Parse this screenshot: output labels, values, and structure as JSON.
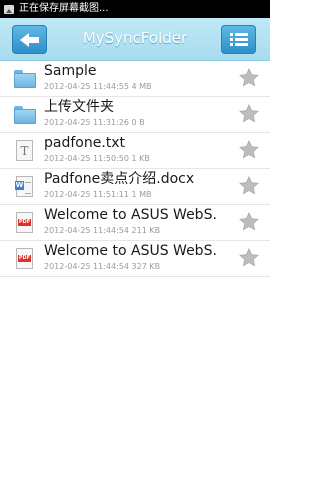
{
  "status_bar": {
    "text": "正在保存屏幕截图..."
  },
  "toolbar": {
    "title": "MySyncFolder"
  },
  "files": [
    {
      "name": "Sample",
      "date": "2012-04-25 11:44:55",
      "size": "4 MB",
      "type": "folder"
    },
    {
      "name": "上传文件夹",
      "date": "2012-04-25 11:31:26",
      "size": "0 B",
      "type": "folder"
    },
    {
      "name": "padfone.txt",
      "date": "2012-04-25 11:50:50",
      "size": "1 KB",
      "type": "txt"
    },
    {
      "name": "Padfone卖点介绍.docx",
      "date": "2012-04-25 11:51:11",
      "size": "1 MB",
      "type": "docx"
    },
    {
      "name": "Welcome to ASUS WebS.",
      "date": "2012-04-25 11:44:54",
      "size": "211 KB",
      "type": "pdf"
    },
    {
      "name": "Welcome to ASUS WebS.",
      "date": "2012-04-25 11:44:54",
      "size": "327 KB",
      "type": "pdf"
    }
  ],
  "colors": {
    "toolbar_bg": "#b3e1f3",
    "button": "#3d9fd6",
    "star": "#bdbdbd"
  }
}
